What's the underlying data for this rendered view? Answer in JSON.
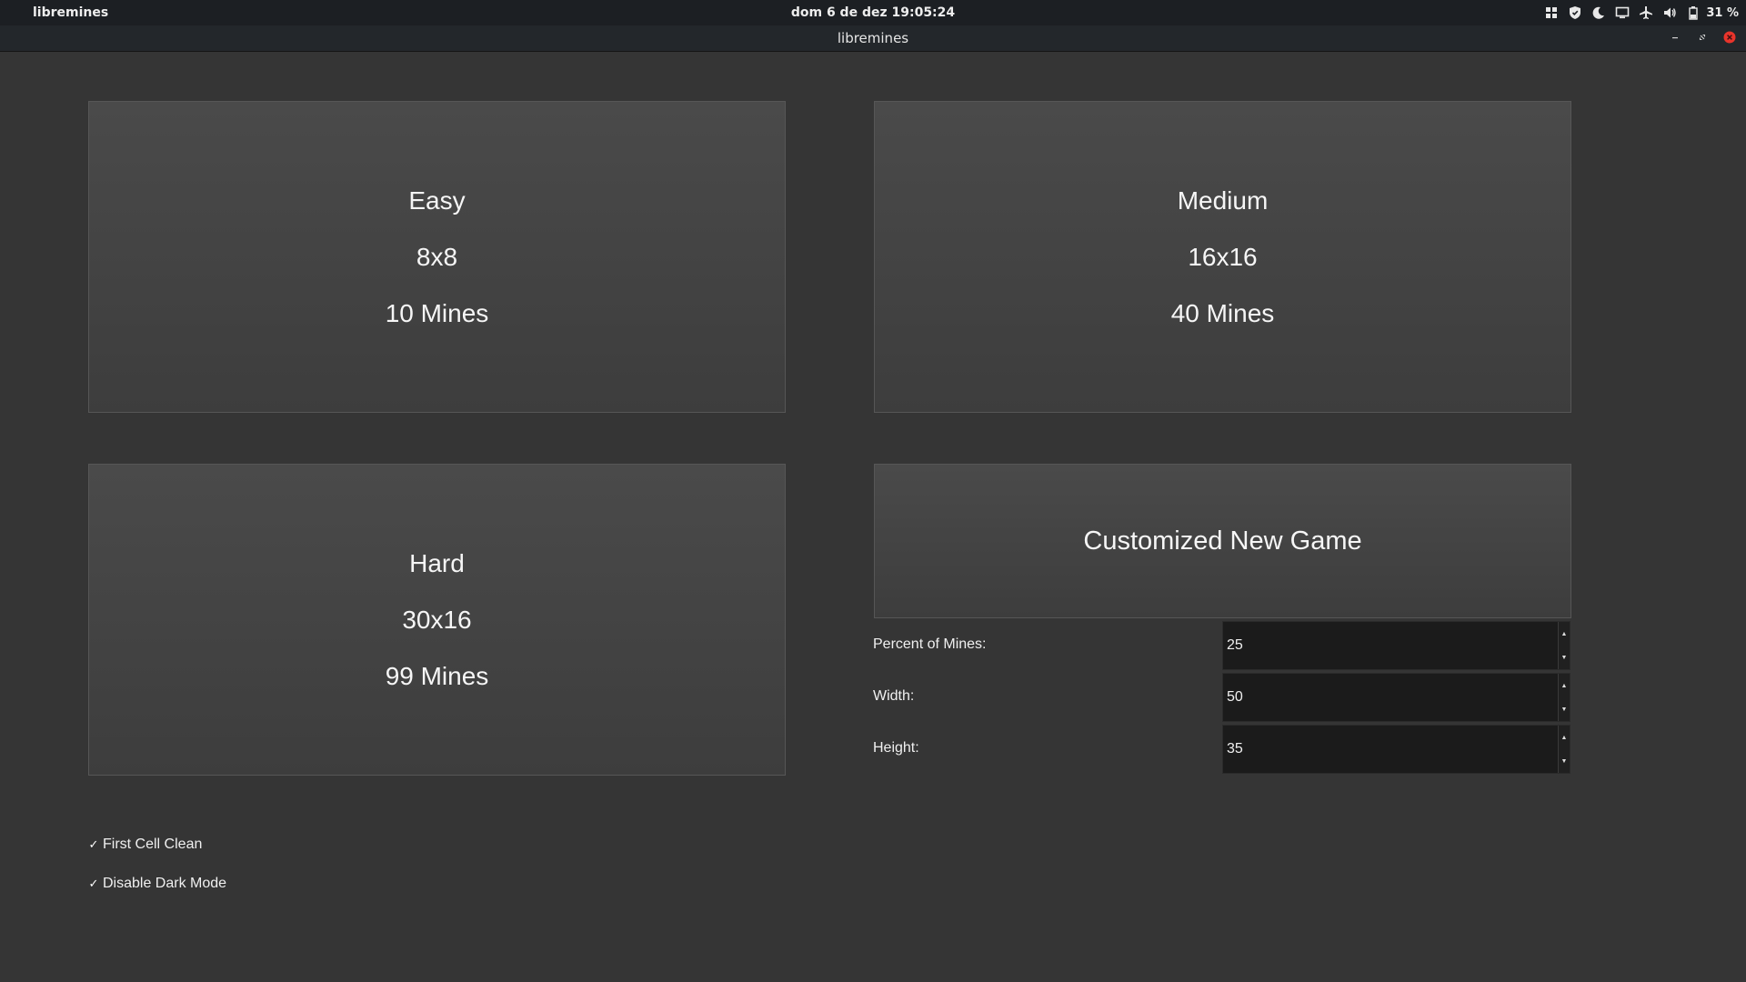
{
  "topbar": {
    "app_menu": "libremines",
    "clock": "dom 6 de dez  19:05:24",
    "battery_percent": "31 %",
    "icons": [
      "grid-icon",
      "shield-icon",
      "night-light-icon",
      "screen-icon",
      "airplane-mode-icon",
      "volume-icon",
      "battery-icon"
    ]
  },
  "window": {
    "title": "libremines",
    "controls": [
      "minimize-icon",
      "maximize-icon",
      "close-icon"
    ]
  },
  "presets": {
    "easy": {
      "name": "Easy",
      "size": "8x8",
      "mines": "10 Mines"
    },
    "medium": {
      "name": "Medium",
      "size": "16x16",
      "mines": "40 Mines"
    },
    "hard": {
      "name": "Hard",
      "size": "30x16",
      "mines": "99 Mines"
    }
  },
  "custom": {
    "button_label": "Customized New Game",
    "percent_label": "Percent of Mines:",
    "percent_value": "25",
    "width_label": "Width:",
    "width_value": "50",
    "height_label": "Height:",
    "height_value": "35"
  },
  "options": {
    "first_cell_clean": {
      "label": "First Cell Clean",
      "checked": true,
      "mark": "✓"
    },
    "disable_dark_mode": {
      "label": "Disable Dark Mode",
      "checked": true,
      "mark": "✓"
    }
  },
  "colors": {
    "background": "#353535",
    "card": "#444444",
    "input": "#1b1b1b",
    "close_button": "#e8342b"
  }
}
